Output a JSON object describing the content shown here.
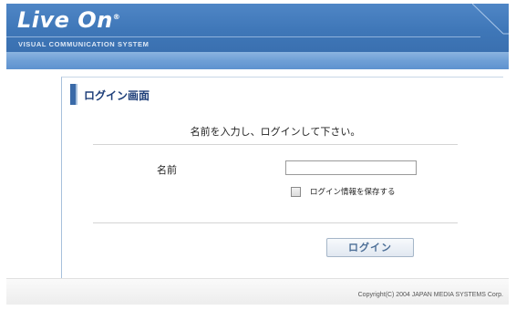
{
  "brand": {
    "logo_text": "Live On",
    "subtitle": "VISUAL COMMUNICATION SYSTEM"
  },
  "panel": {
    "title": "ログイン画面",
    "instruction": "名前を入力し、ログインして下さい。"
  },
  "form": {
    "name_label": "名前",
    "name_value": "",
    "remember_label": "ログイン情報を保存する",
    "remember_checked": false,
    "login_button": "ログイン"
  },
  "footer": {
    "copyright": "Copyright(C) 2004 JAPAN MEDIA SYSTEMS Corp."
  },
  "colors": {
    "header": "#3f77b8",
    "bar": "#6f9fd6",
    "title_text": "#1e3f7a"
  }
}
